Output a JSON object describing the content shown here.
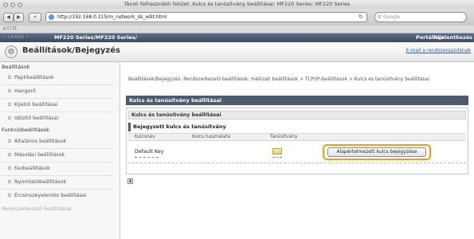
{
  "window": {
    "title": "Távoli felhasználói felület: Kulcs és tanúsítvány beállításai: MF220 Series: MF220 Series"
  },
  "toolbar": {
    "back": "◀",
    "forward": "▶",
    "add": "+",
    "url": "http://192.168.0.215/m_network_ds_edit.html",
    "search_placeholder": "Google",
    "bookmarks": "⌂ ☐ ☷"
  },
  "header": {
    "product": "MF220 Series/MF220 Series/",
    "portal": "Portálhoz",
    "logout": "Kijelentkezés",
    "page_title": "Beállítások/Bejegyzés",
    "mail_admin": "E-mail a rendszergazdának"
  },
  "sidebar": {
    "heading1": "Beállítások",
    "items1": [
      "Papírbeállítások",
      "Hangerő",
      "Kijelző beállításai",
      "Időzítő beállításai"
    ],
    "heading2": "Funkcióbeállítások",
    "items2": [
      "Általános beállítások",
      "Másolási beállítások",
      "Faxbeállítások",
      "Nyomtatóbeállítások",
      "Ércsinszeyelentés beállításai"
    ],
    "heading3": "Rendszerkezelő beállítások"
  },
  "main": {
    "breadcrumb": "Beállítások/Bejegyzés: Rendszerkezelő beállítások: Hálózati beállítások > TCP/IP-beállítások > Kulcs és tanúsítvány beállításai",
    "section_title": "Kulcs és tanúsítvány beállításai",
    "subsection_title": "Kulcs és tanúsítvány beállításai",
    "registered_title": "Bejegyzett kulcs és tanúsítvány",
    "columns": [
      "Kulcsnév",
      "Kulcs használata",
      "Tanúsítvány"
    ],
    "rows": [
      {
        "key_name": "Default Key",
        "key_usage": ""
      }
    ],
    "default_key_button": "Alapértelmezett kulcs bejegyzése",
    "to_top": "▲"
  },
  "colors": {
    "highlight": "#f39a1e",
    "section_bar": "#4d5b70"
  }
}
